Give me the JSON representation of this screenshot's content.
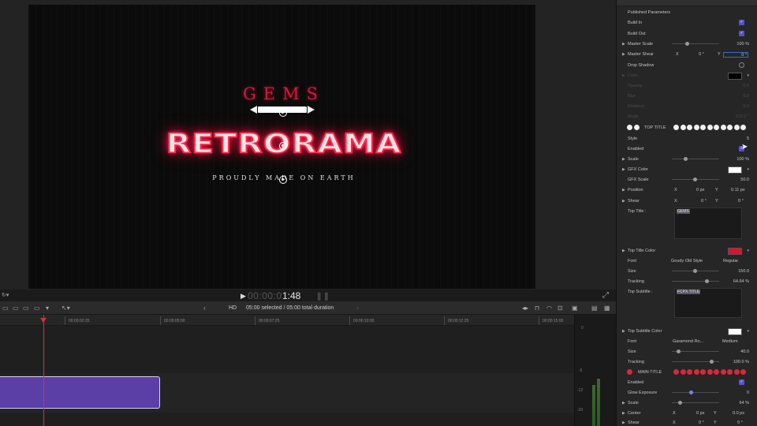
{
  "viewer": {
    "top_title": "GEMS",
    "main_title": "RETRORAMA",
    "subtitle": "PROUDLY MADE ON EARTH",
    "timecode_dim": "00:00:0",
    "timecode": "1:48"
  },
  "toolbar": {
    "hd_label": "HD",
    "selection_info": "05:00 selected / 05:00 total duration"
  },
  "timeline": {
    "ticks": [
      "00:00:02:25",
      "00:00:05:00",
      "00:00:07:25",
      "00:00:10:00",
      "00:00:12:25",
      "00:00:15:00"
    ],
    "clip_color": "#5b3fa7",
    "playhead_color": "#d0343f"
  },
  "meters": {
    "labels": [
      "0",
      "-6",
      "-12",
      "-20"
    ]
  },
  "inspector": {
    "section": "Published Parameters",
    "build_in": "Build In",
    "build_out": "Build Out",
    "master_scale": "Master Scale",
    "master_scale_val": "100 %",
    "master_shear": "Master Shear",
    "master_shear_x": "0 °",
    "master_shear_y": "0 °",
    "drop_shadow": "Drop Shadow",
    "dim_color": "Color",
    "dim_opacity": "Opacity",
    "dim_opacity_val": "0.0",
    "dim_blur": "Blur",
    "dim_blur_val": "0.0",
    "dim_distance": "Distance",
    "dim_distance_val": "0.0",
    "dim_angle": "Angle",
    "dim_angle_val": "315.0 °",
    "top_title_label": "TOP TITLE",
    "style": "Style",
    "style_val": "5",
    "enabled": "Enabled",
    "scale": "Scale",
    "scale_val": "100 %",
    "gfx_color": "GFX Color",
    "gfx_scale": "GFX Scale",
    "gfx_scale_val": "50.0",
    "position": "Position",
    "position_x": "0 px",
    "position_y": "0.11 px",
    "shear": "Shear",
    "shear_x": "0 °",
    "shear_y": "0 °",
    "top_title_field": "Top Title :",
    "top_title_value": "GEMS",
    "top_title_color": "Top Title Color",
    "top_title_color_hex": "#e0102e",
    "font": "Font",
    "font_family": "Goudy Old Style",
    "font_weight": "Regular",
    "size": "Size",
    "size_val": "150.0",
    "tracking": "Tracking",
    "tracking_val": "64.64 %",
    "top_subtitle_field": "Top Subtitle :",
    "top_subtitle_value": "FCPX TITLE",
    "top_subtitle_color": "Top Subtitle Color",
    "font2_family": "Garamond Ro...",
    "font2_weight": "Medium",
    "size2_val": "40.0",
    "tracking2_val": "100.0 %",
    "main_title_label": "MAIN TITLE",
    "enabled2": "Enabled",
    "glow_exposure": "Glow Exposure",
    "glow_exposure_val": "0",
    "scale2_val": "64 %",
    "center": "Center",
    "center_x": "0 px",
    "center_y": "0.0 px",
    "shear3": "Shear",
    "shear3_x": "0 °",
    "shear3_y": "0 °",
    "x_label": "X",
    "y_label": "Y",
    "accent": "#5a4fcf"
  }
}
